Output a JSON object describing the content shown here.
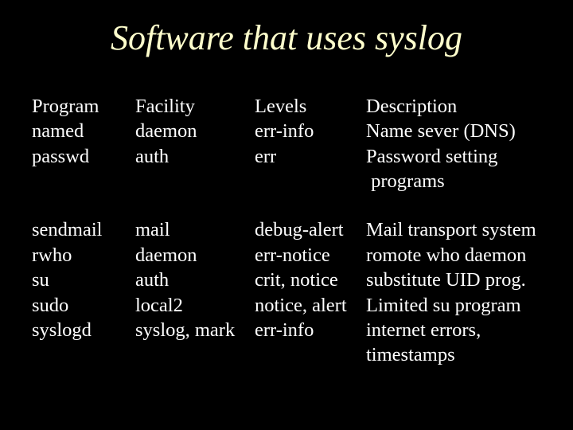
{
  "title": "Software that uses syslog",
  "headers": {
    "program": "Program",
    "facility": "Facility",
    "levels": "Levels",
    "description": "Description"
  },
  "rows": [
    {
      "program": "named",
      "facility": "daemon",
      "levels": "err-info",
      "description": "Name sever (DNS)"
    },
    {
      "program": "passwd",
      "facility": "auth",
      "levels": "err",
      "description": "Password setting\n programs"
    },
    {
      "program": "sendmail",
      "facility": "mail",
      "levels": "debug-alert",
      "description": "Mail transport system"
    },
    {
      "program": "rwho",
      "facility": "daemon",
      "levels": "err-notice",
      "description": "romote who daemon"
    },
    {
      "program": "su",
      "facility": "auth",
      "levels": "crit, notice",
      "description": "substitute UID prog."
    },
    {
      "program": "sudo",
      "facility": "local2",
      "levels": "notice, alert",
      "description": "Limited su program"
    },
    {
      "program": "syslogd",
      "facility": "syslog, mark",
      "levels": "err-info",
      "description": "internet errors,\ntimestamps"
    }
  ]
}
